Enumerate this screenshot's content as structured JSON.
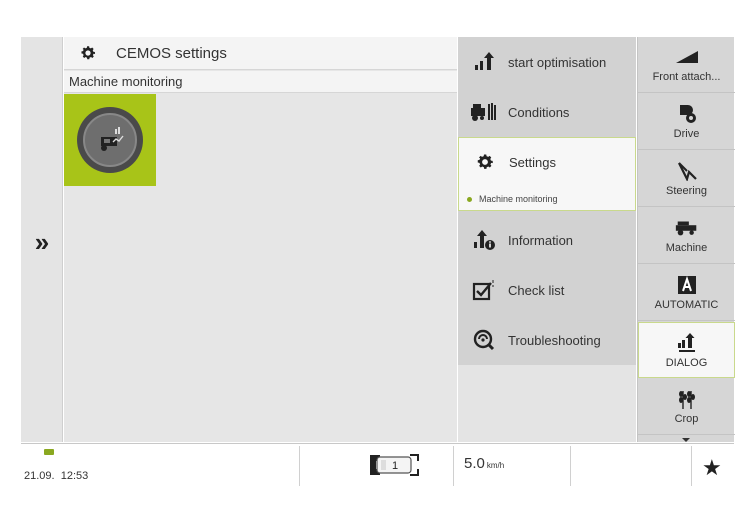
{
  "main": {
    "title": "CEMOS settings",
    "subtitle": "Machine monitoring"
  },
  "menu": {
    "items": [
      {
        "label": "start optimisation",
        "icon": "optimisation-icon"
      },
      {
        "label": "Conditions",
        "icon": "conditions-icon"
      },
      {
        "label": "Settings",
        "icon": "gear-icon",
        "sub": "Machine monitoring"
      },
      {
        "label": "Information",
        "icon": "information-icon"
      },
      {
        "label": "Check list",
        "icon": "checklist-icon"
      },
      {
        "label": "Troubleshooting",
        "icon": "troubleshooting-icon"
      }
    ]
  },
  "rnav": {
    "items": [
      {
        "label": "Front attach...",
        "icon": "front-attachment-icon"
      },
      {
        "label": "Drive",
        "icon": "drive-icon"
      },
      {
        "label": "Steering",
        "icon": "steering-icon"
      },
      {
        "label": "Machine",
        "icon": "machine-icon"
      },
      {
        "label": "AUTOMATIC",
        "icon": "automatic-icon"
      },
      {
        "label": "DIALOG",
        "icon": "dialog-icon"
      },
      {
        "label": "Crop",
        "icon": "crop-icon"
      }
    ]
  },
  "status": {
    "date": "21.09.",
    "time": "12:53",
    "speed_value": "5.0",
    "speed_unit": "km/h",
    "gear": "1"
  },
  "colors": {
    "accent": "#a8c418",
    "panel": "#e6e6e6",
    "menu": "#d2d2d2"
  }
}
